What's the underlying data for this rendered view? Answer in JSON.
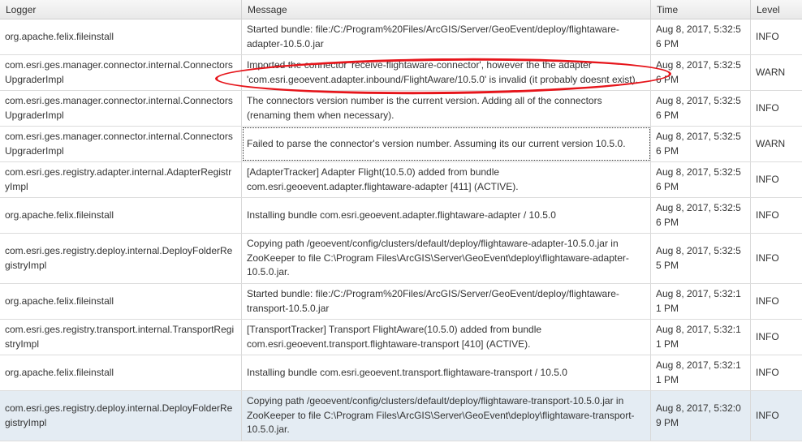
{
  "columns": {
    "logger": "Logger",
    "message": "Message",
    "time": "Time",
    "level": "Level"
  },
  "rows": [
    {
      "logger": "org.apache.felix.fileinstall",
      "message": "Started bundle: file:/C:/Program%20Files/ArcGIS/Server/GeoEvent/deploy/flightaware-adapter-10.5.0.jar",
      "time": "Aug 8, 2017, 5:32:56 PM",
      "level": "INFO"
    },
    {
      "logger": "com.esri.ges.manager.connector.internal.ConnectorsUpgraderImpl",
      "message": "Imported the connector 'receive-flightaware-connector', however the the adapter 'com.esri.geoevent.adapter.inbound/FlightAware/10.5.0' is invalid (it probably doesnt exist).",
      "time": "Aug 8, 2017, 5:32:56 PM",
      "level": "WARN"
    },
    {
      "logger": "com.esri.ges.manager.connector.internal.ConnectorsUpgraderImpl",
      "message": "The connectors version number is the current version. Adding all of the connectors (renaming them when necessary).",
      "time": "Aug 8, 2017, 5:32:56 PM",
      "level": "INFO"
    },
    {
      "logger": "com.esri.ges.manager.connector.internal.ConnectorsUpgraderImpl",
      "message": "Failed to parse the connector's version number. Assuming its our current version 10.5.0.",
      "time": "Aug 8, 2017, 5:32:56 PM",
      "level": "WARN"
    },
    {
      "logger": "com.esri.ges.registry.adapter.internal.AdapterRegistryImpl",
      "message": "[AdapterTracker] Adapter Flight(10.5.0) added from bundle com.esri.geoevent.adapter.flightaware-adapter [411] (ACTIVE).",
      "time": "Aug 8, 2017, 5:32:56 PM",
      "level": "INFO"
    },
    {
      "logger": "org.apache.felix.fileinstall",
      "message": "Installing bundle com.esri.geoevent.adapter.flightaware-adapter / 10.5.0",
      "time": "Aug 8, 2017, 5:32:56 PM",
      "level": "INFO"
    },
    {
      "logger": "com.esri.ges.registry.deploy.internal.DeployFolderRegistryImpl",
      "message": "Copying path /geoevent/config/clusters/default/deploy/flightaware-adapter-10.5.0.jar in ZooKeeper to file C:\\Program Files\\ArcGIS\\Server\\GeoEvent\\deploy\\flightaware-adapter-10.5.0.jar.",
      "time": "Aug 8, 2017, 5:32:55 PM",
      "level": "INFO"
    },
    {
      "logger": "org.apache.felix.fileinstall",
      "message": "Started bundle: file:/C:/Program%20Files/ArcGIS/Server/GeoEvent/deploy/flightaware-transport-10.5.0.jar",
      "time": "Aug 8, 2017, 5:32:11 PM",
      "level": "INFO"
    },
    {
      "logger": "com.esri.ges.registry.transport.internal.TransportRegistryImpl",
      "message": "[TransportTracker] Transport FlightAware(10.5.0) added from bundle com.esri.geoevent.transport.flightaware-transport [410] (ACTIVE).",
      "time": "Aug 8, 2017, 5:32:11 PM",
      "level": "INFO"
    },
    {
      "logger": "org.apache.felix.fileinstall",
      "message": "Installing bundle com.esri.geoevent.transport.flightaware-transport / 10.5.0",
      "time": "Aug 8, 2017, 5:32:11 PM",
      "level": "INFO"
    },
    {
      "logger": "com.esri.ges.registry.deploy.internal.DeployFolderRegistryImpl",
      "message": "Copying path /geoevent/config/clusters/default/deploy/flightaware-transport-10.5.0.jar in ZooKeeper to file C:\\Program Files\\ArcGIS\\Server\\GeoEvent\\deploy\\flightaware-transport-10.5.0.jar.",
      "time": "Aug 8, 2017, 5:32:09 PM",
      "level": "INFO"
    }
  ],
  "selected_row": 10,
  "focused_row": 3,
  "annotation_row": 1,
  "colors": {
    "annotation": "#e6151b",
    "selected_row": "#e4ecf3"
  }
}
